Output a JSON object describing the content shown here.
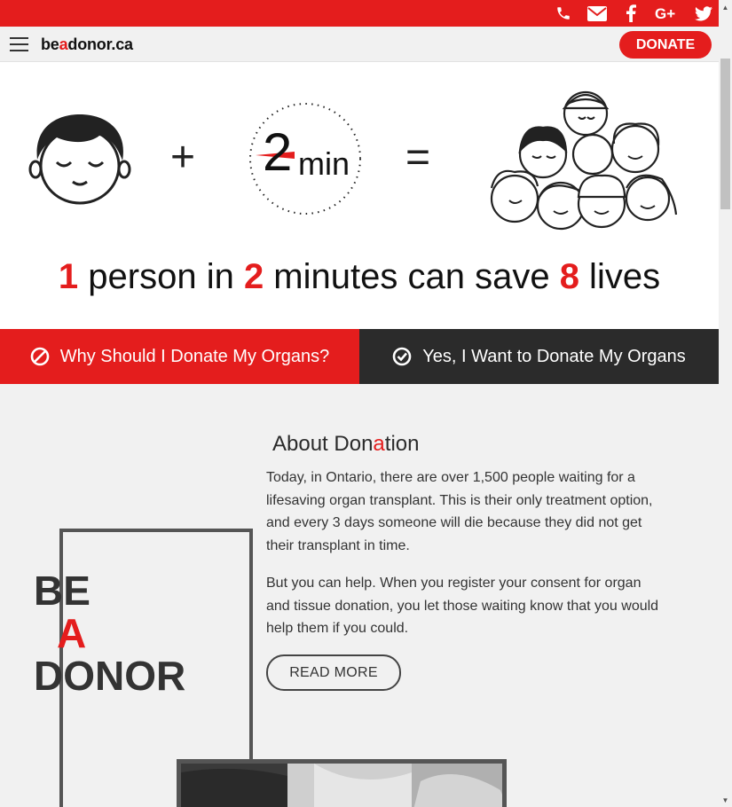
{
  "topbar": {
    "icons": [
      "phone-icon",
      "envelope-icon",
      "facebook-icon",
      "google-plus-icon",
      "twitter-icon"
    ],
    "color": "#e41d1d"
  },
  "header": {
    "logo_prefix": "be",
    "logo_accent": "a",
    "logo_suffix": "donor.ca",
    "donate_label": "DONATE"
  },
  "hero": {
    "plus": "+",
    "equals": "=",
    "timer_number": "2",
    "timer_unit": "min",
    "tagline": {
      "n1": "1",
      "t1": " person in ",
      "n2": "2",
      "t2": " minutes can save ",
      "n3": "8",
      "t3": " lives"
    }
  },
  "actions": {
    "why_label": "Why Should I Donate My Organs?",
    "yes_label": "Yes, I Want to Donate My Organs"
  },
  "about": {
    "title_a": "About Don",
    "title_accent": "a",
    "title_b": "tion",
    "p1": "Today, in Ontario, there are over 1,500 people waiting for a lifesaving organ transplant. This is their only treatment option, and every 3 days someone will die because they did not get their transplant in time.",
    "p2": "But you can help. When you register your consent for organ and tissue donation, you let those waiting know that you would help them if you could.",
    "read_more": "READ MORE"
  },
  "badge": {
    "line1": "BE",
    "line2": "A",
    "line3": "DONOR"
  },
  "colors": {
    "brand_red": "#e41d1d",
    "dark": "#2b2b2b"
  }
}
